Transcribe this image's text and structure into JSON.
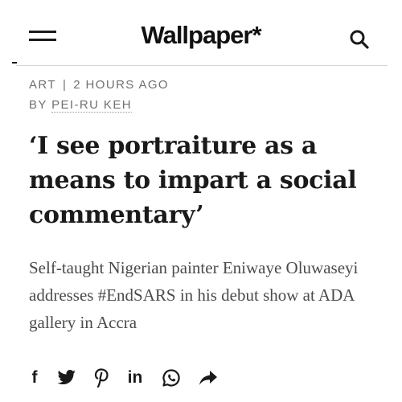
{
  "header": {
    "logo": "Wallpaper*",
    "icons": {
      "menu": "menu-icon",
      "search": "search-icon"
    }
  },
  "article": {
    "category": "ART",
    "separator": "|",
    "time": "2 HOURS AGO",
    "byline_prefix": "BY",
    "author": "PEI-RU KEH",
    "headline": "‘I see portraiture as a means to impart a social commentary’",
    "standfirst": "Self-taught Nigerian painter Eniwaye Oluwaseyi addresses #EndSARS in his debut show at ADA gallery in Accra"
  },
  "share": {
    "facebook_glyph": "f",
    "linkedin_glyph": "in",
    "icons": [
      "facebook-icon",
      "twitter-icon",
      "pinterest-icon",
      "linkedin-icon",
      "whatsapp-icon",
      "share-icon"
    ]
  },
  "colors": {
    "text": "#1a1a1a",
    "meta": "#707070",
    "standfirst": "#4a4a4a",
    "divider": "#d6d6d6"
  }
}
